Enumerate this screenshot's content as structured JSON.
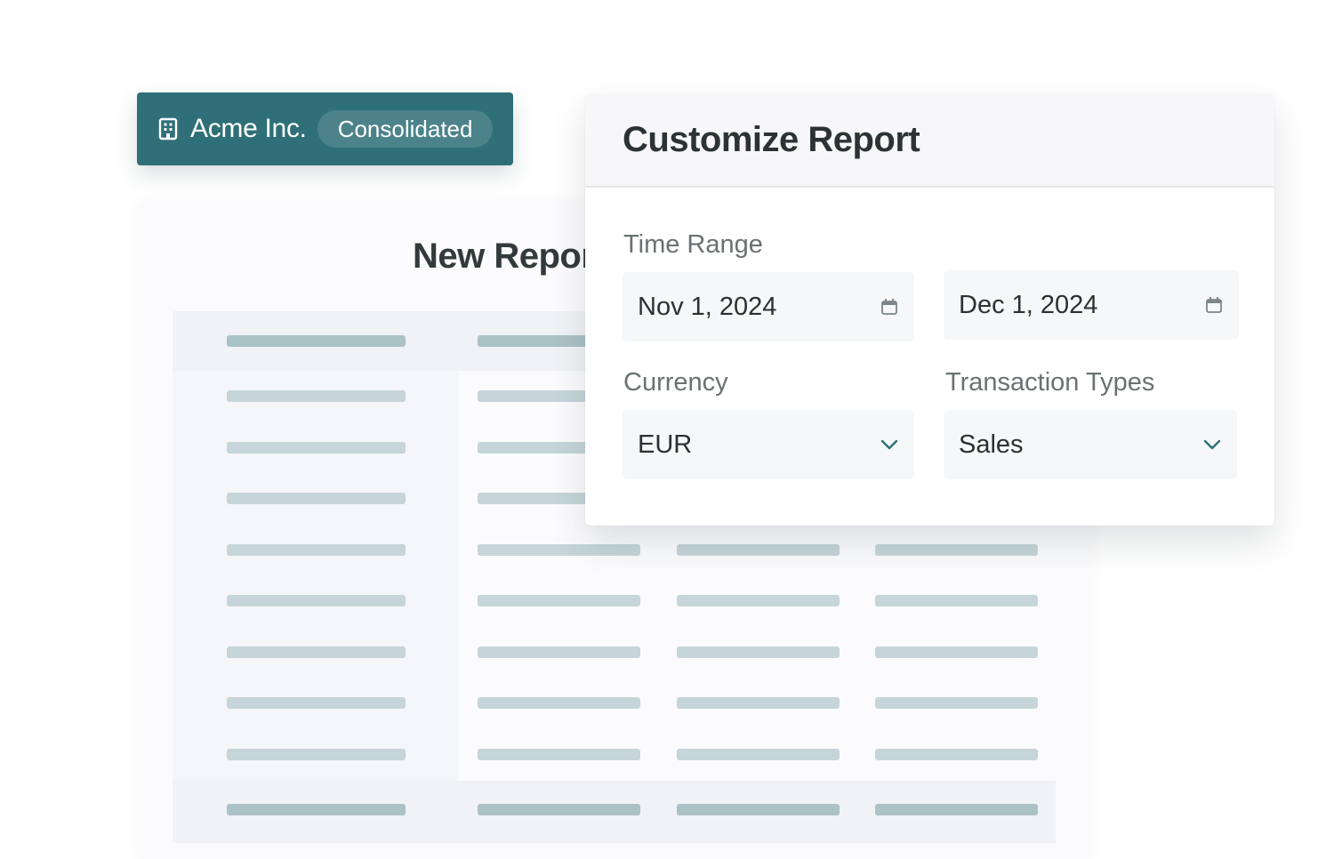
{
  "company": {
    "name": "Acme Inc.",
    "scope": "Consolidated",
    "icon": "building-icon"
  },
  "report": {
    "title": "New Report"
  },
  "customize": {
    "title": "Customize Report",
    "time_range": {
      "label": "Time Range",
      "start": "Nov 1, 2024",
      "end": "Dec 1, 2024",
      "icon": "calendar-icon"
    },
    "currency": {
      "label": "Currency",
      "value": "EUR",
      "icon": "chevron-down-icon"
    },
    "transaction_types": {
      "label": "Transaction Types",
      "value": "Sales",
      "icon": "chevron-down-icon"
    }
  },
  "colors": {
    "brand": "#2f6f78",
    "placeholder_bar": "#c5d5d9",
    "placeholder_bar_dark": "#abc2c7"
  }
}
